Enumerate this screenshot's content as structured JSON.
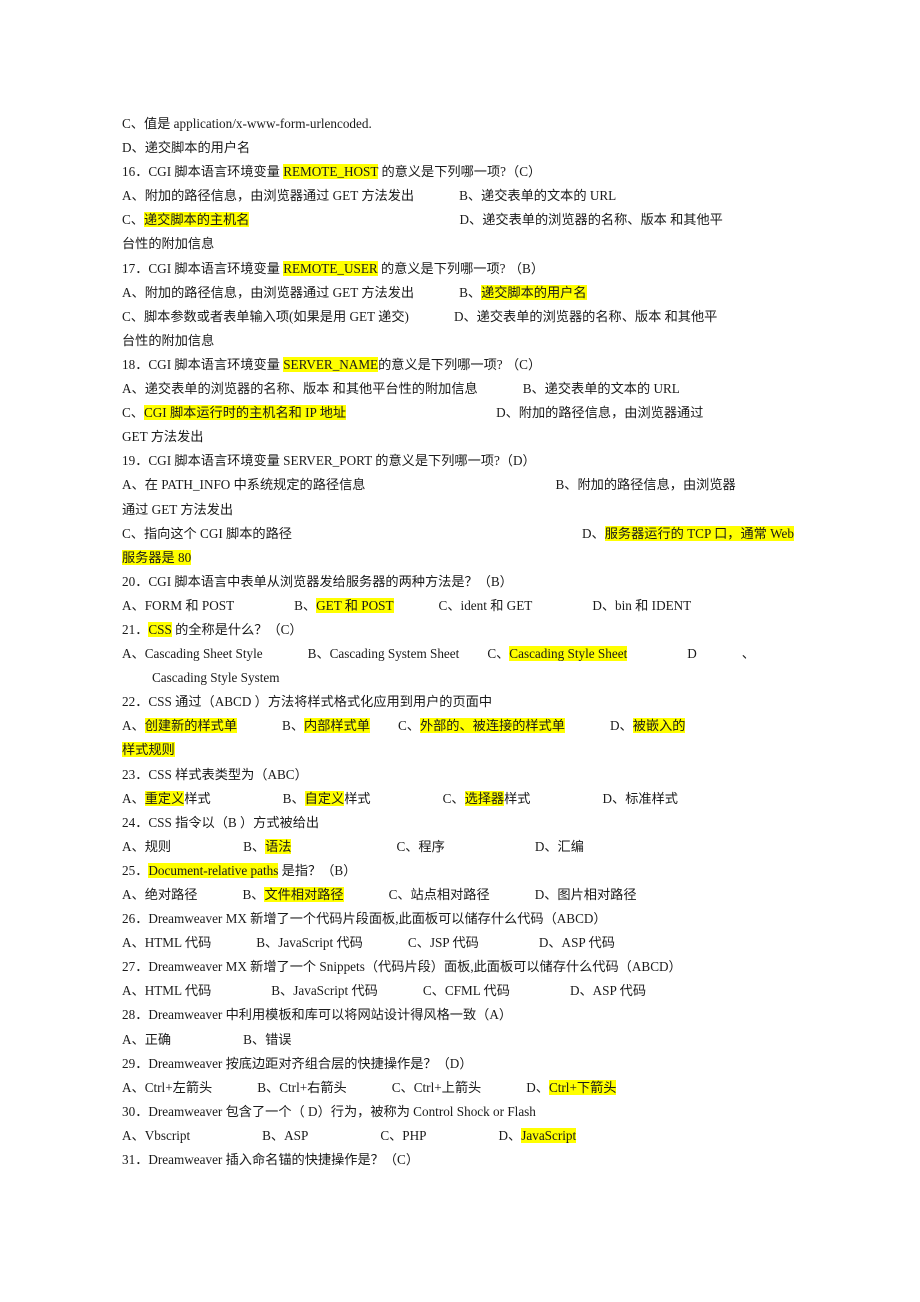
{
  "document": {
    "type": "exam-question-bank",
    "language": "zh-CN",
    "highlight_color": "#ffff00",
    "text_color": "#1a1a1a",
    "page_background": "#ffffff"
  },
  "lines": {
    "l01": "C、值是  application/x-www-form-urlencoded.",
    "l02": "D、递交脚本的用户名",
    "q16": {
      "prefix": "16．CGI 脚本语言环境变量 ",
      "highlight": "REMOTE_HOST",
      "suffix": " 的意义是下列哪一项?（C）"
    },
    "q16_A": "A、附加的路径信息，由浏览器通过 GET 方法发出",
    "q16_B": "B、递交表单的文本的 URL",
    "q16_C_label": "C、",
    "q16_C_hl": "递交脚本的主机名",
    "q16_D": "D、递交表单的浏览器的名称、版本 和其他平",
    "q16_D_cont": "台性的附加信息",
    "q17": {
      "prefix": "17．CGI 脚本语言环境变量 ",
      "highlight": "REMOTE_USER",
      "suffix": " 的意义是下列哪一项?   （B）"
    },
    "q17_A": "A、附加的路径信息，由浏览器通过 GET 方法发出",
    "q17_B_label": "B、",
    "q17_B_hl": "递交脚本的用户名",
    "q17_C": "C、脚本参数或者表单输入项(如果是用 GET 递交)",
    "q17_D": "D、递交表单的浏览器的名称、版本 和其他平",
    "q17_D_cont": "台性的附加信息",
    "q18": {
      "prefix": "18．CGI 脚本语言环境变量 ",
      "highlight": "SERVER_NAME",
      "suffix": "的意义是下列哪一项?  （C）"
    },
    "q18_A": "A、递交表单的浏览器的名称、版本 和其他平台性的附加信息",
    "q18_B": "B、递交表单的文本的 URL",
    "q18_C_label": "C、",
    "q18_C_hl": "CGI 脚本运行时的主机名和 IP 地址",
    "q18_D": "D、附加的路径信息，由浏览器通过",
    "q18_D_cont": "GET 方法发出",
    "q19": "19．CGI 脚本语言环境变量 SERVER_PORT 的意义是下列哪一项?（D）",
    "q19_A": "A、在 PATH_INFO 中系统规定的路径信息",
    "q19_B": "B、附加的路径信息，由浏览器",
    "q19_B_cont": "通过 GET 方法发出",
    "q19_C": "C、指向这个 CGI 脚本的路径",
    "q19_D_label": "D、",
    "q19_D_hl": "服务器运行的 TCP 口，通常 Web",
    "q19_D_cont_hl": "服务器是 80",
    "q20": "20．CGI 脚本语言中表单从浏览器发给服务器的两种方法是？（B）",
    "q20_A": "A、FORM 和 POST",
    "q20_B_label": "B、",
    "q20_B_hl": "GET  和  POST",
    "q20_C": "C、ident 和 GET",
    "q20_D": "D、bin 和 IDENT",
    "q21": {
      "prefix": "21．",
      "highlight": "CSS",
      "suffix": " 的全称是什么？（C）"
    },
    "q21_A": "A、Cascading Sheet Style",
    "q21_B": "B、Cascading System Sheet",
    "q21_C_label": "C、",
    "q21_C_hl": "Cascading Style Sheet",
    "q21_D_label": "D",
    "q21_D_mark": "、",
    "q21_D_cont": "Cascading Style System",
    "q22": "22．CSS 通过（ABCD ）方法将样式格式化应用到用户的页面中",
    "q22_A_label": "A、",
    "q22_A_hl": "创建新的样式单",
    "q22_B_label": "B、",
    "q22_B_hl": "内部样式单",
    "q22_C_label": "C、",
    "q22_C_hl": "外部的、被连接的样式单",
    "q22_D_label": "D、",
    "q22_D_hl": "被嵌入的",
    "q22_D_cont_hl": "样式规则",
    "q23": "23．CSS 样式表类型为（ABC）",
    "q23_A_label": "A、",
    "q23_A_hl": "重定义",
    "q23_A_rest": "样式",
    "q23_B_label": "B、",
    "q23_B_hl": "自定义",
    "q23_B_rest": "样式",
    "q23_C_label": "C、",
    "q23_C_hl": "选择器",
    "q23_C_rest": "样式",
    "q23_D": "D、标准样式",
    "q24": "24．CSS 指令以（B ）方式被给出",
    "q24_A": "A、规则",
    "q24_B_label": "B、",
    "q24_B_hl": "语法",
    "q24_C": "C、程序",
    "q24_D": "D、汇编",
    "q25": {
      "prefix": "25．",
      "highlight": "Document-relative paths",
      "suffix": " 是指？（B）"
    },
    "q25_A": "A、绝对路径",
    "q25_B_label": "B、",
    "q25_B_hl": "文件相对路径",
    "q25_C": "C、站点相对路径",
    "q25_D": "D、图片相对路径",
    "q26": "26．Dreamweaver MX  新增了一个代码片段面板,此面板可以储存什么代码（ABCD）",
    "q26_A": "A、HTML  代码",
    "q26_B": "B、JavaScript  代码",
    "q26_C": "C、JSP  代码",
    "q26_D": "D、ASP  代码",
    "q27": "27．Dreamweaver MX  新增了一个 Snippets（代码片段）面板,此面板可以储存什么代码（ABCD）",
    "q27_A": "A、HTML 代码",
    "q27_B": "B、JavaScript 代码",
    "q27_C": "C、CFML 代码",
    "q27_D": "D、ASP 代码",
    "q28": "28．Dreamweaver  中利用模板和库可以将网站设计得风格一致（A）",
    "q28_A": "A、正确",
    "q28_B": "B、错误",
    "q29": "29．Dreamweaver 按底边距对齐组合层的快捷操作是？（D）",
    "q29_A": "A、Ctrl+左箭头",
    "q29_B": "B、Ctrl+右箭头",
    "q29_C": "C、Ctrl+上箭头",
    "q29_D_label": "D、",
    "q29_D_hl": "Ctrl+下箭头",
    "q30": "30．Dreamweaver 包含了一个（ D）行为，被称为 Control Shock or Flash",
    "q30_A": "A、Vbscript",
    "q30_B": "B、ASP",
    "q30_C": "C、PHP",
    "q30_D_label": "D、",
    "q30_D_hl": "JavaScript",
    "q31": "31．Dreamweaver 插入命名锚的快捷操作是？（C）"
  }
}
